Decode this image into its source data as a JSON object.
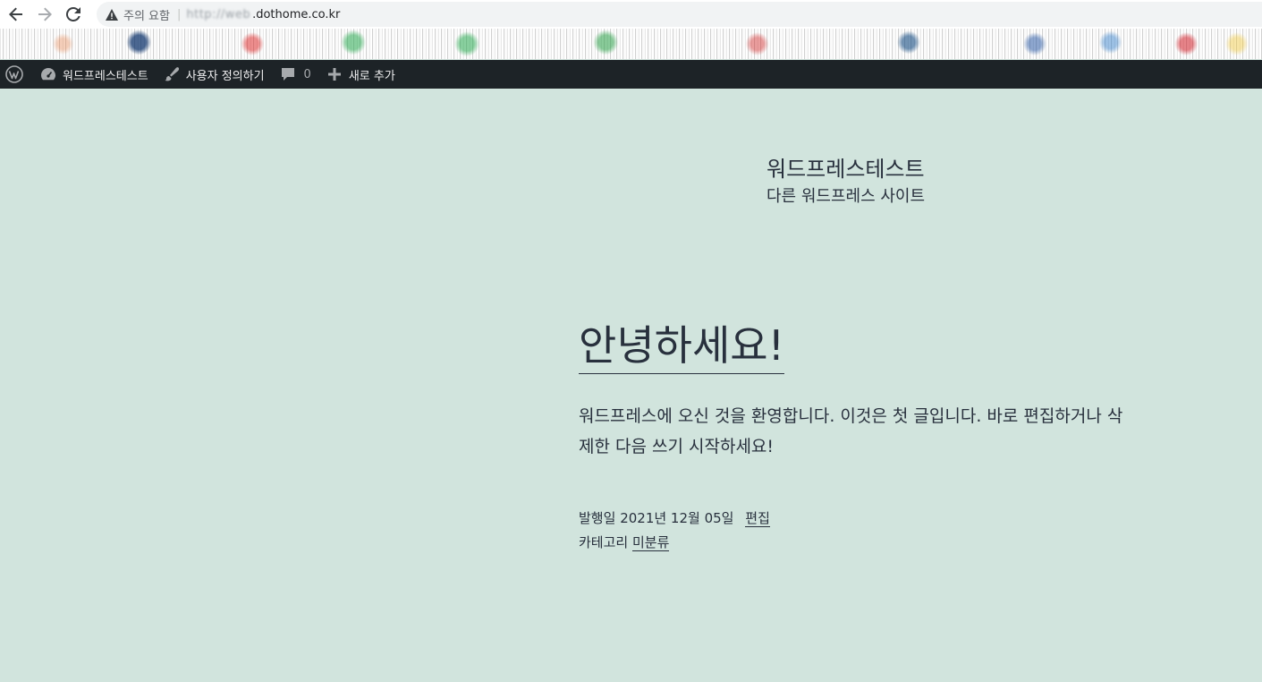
{
  "browser": {
    "security_label": "주의 요함",
    "separator": "|",
    "url_blurred": "http://web",
    "url_domain": ".dothome.co.kr"
  },
  "admin_bar": {
    "site_name": "워드프레스테스트",
    "customize": "사용자 정의하기",
    "comments_count": "0",
    "new_content": "새로 추가",
    "icons": [
      "wordpress-icon",
      "dashboard-icon",
      "brush-icon",
      "comment-icon",
      "plus-icon"
    ]
  },
  "site": {
    "title": "워드프레스테스트",
    "description": "다른 워드프레스 사이트"
  },
  "post": {
    "title": "안녕하세요!",
    "excerpt": "워드프레스에 오신 것을 환영합니다. 이것은 첫 글입니다. 바로 편집하거나 삭제한 다음 쓰기 시작하세요!",
    "published_label": "발행일",
    "published_date": "2021년 12월 05일",
    "edit_label": "편집",
    "category_label": "카테고리",
    "category": "미분류"
  },
  "colors": {
    "page_background": "#d1e4dd",
    "admin_bar_background": "#1d2327",
    "text": "#28303d"
  }
}
